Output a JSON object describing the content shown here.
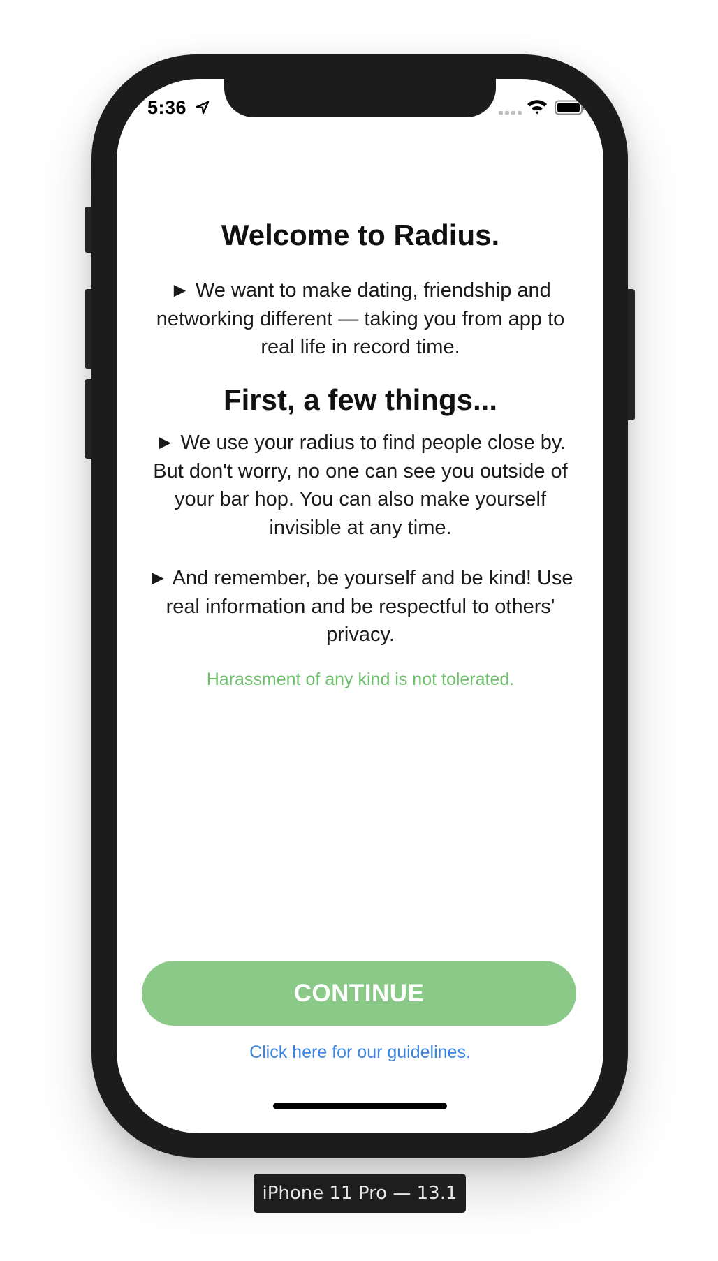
{
  "status_bar": {
    "time": "5:36"
  },
  "onboarding": {
    "title": "Welcome to Radius.",
    "intro": "► We want to make dating, friendship and networking different — taking you from app to real life in record time.",
    "subtitle": "First, a few things...",
    "point_radius": "► We use your radius to find people close by. But don't worry, no one can see you outside of your bar hop. You can also make yourself invisible at any time.",
    "point_kind": "► And remember, be yourself and be kind! Use real information and be respectful to others' privacy.",
    "warning": "Harassment of any kind is not tolerated.",
    "continue_label": "CONTINUE",
    "guidelines_link": "Click here for our guidelines."
  },
  "simulator": {
    "device_label": "iPhone 11 Pro — 13.1"
  },
  "colors": {
    "accent_green": "#8bc988",
    "warning_green": "#6ec06c",
    "link_blue": "#3b86e2",
    "device_frame": "#1c1c1c"
  }
}
